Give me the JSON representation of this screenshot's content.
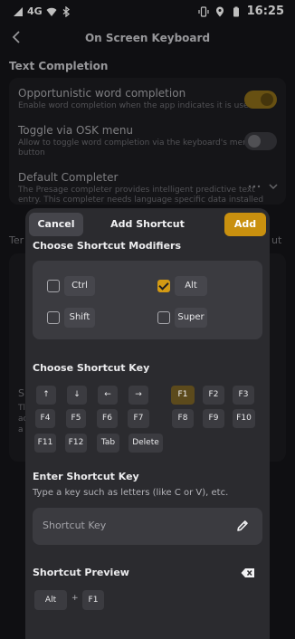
{
  "status_bar": {
    "network": "4G",
    "time": "16:25"
  },
  "app_bar": {
    "title": "On Screen Keyboard"
  },
  "background": {
    "section_title": "Text Completion",
    "opportunistic": {
      "title": "Opportunistic word completion",
      "subtitle": "Enable word completion when the app indicates it is useful",
      "on": true
    },
    "toggle_osk": {
      "title": "Toggle via OSK menu",
      "subtitle_1": "Allow to toggle word completion via the keyboard's menu",
      "subtitle_2": "button",
      "on": false
    },
    "default_completer": {
      "title": "Default Completer",
      "subtitle_1": "The Presage completer provides intelligent predictive text",
      "subtitle_2": "entry. This completer needs language specific data installed"
    },
    "partial_left_1": "Ter",
    "partial_right_1": "ut",
    "partial_left_2": "S",
    "partial_left_3": "Tl",
    "partial_left_4": "ac",
    "partial_left_5": "a"
  },
  "dialog": {
    "cancel_label": "Cancel",
    "title": "Add Shortcut",
    "add_label": "Add",
    "modifiers_title": "Choose Shortcut Modifiers",
    "modifiers": [
      {
        "label": "Ctrl",
        "checked": false
      },
      {
        "label": "Alt",
        "checked": true
      },
      {
        "label": "Shift",
        "checked": false
      },
      {
        "label": "Super",
        "checked": false
      }
    ],
    "key_title": "Choose Shortcut Key",
    "keys": [
      "↑",
      "↓",
      "←",
      "→",
      "F1",
      "F2",
      "F3",
      "F4",
      "F5",
      "F6",
      "F7",
      "F8",
      "F9",
      "F10",
      "F11",
      "F12",
      "Tab",
      "Delete"
    ],
    "selected_key": "F1",
    "enter_title": "Enter Shortcut Key",
    "enter_hint": "Type a key such as letters (like C or V), etc.",
    "field_placeholder": "Shortcut Key",
    "preview_title": "Shortcut Preview",
    "preview_modifier": "Alt",
    "preview_plus": "+",
    "preview_key": "F1"
  },
  "colors": {
    "accent": "#c9900f",
    "dialog_bg": "#2b2b2f",
    "page_bg": "#151518"
  },
  "icons": [
    "back-arrow-icon",
    "pencil-icon",
    "backspace-icon",
    "chevron-down-icon",
    "more-dots-icon",
    "wifi-icon",
    "bluetooth-icon",
    "vibrate-icon",
    "location-icon",
    "battery-icon"
  ]
}
